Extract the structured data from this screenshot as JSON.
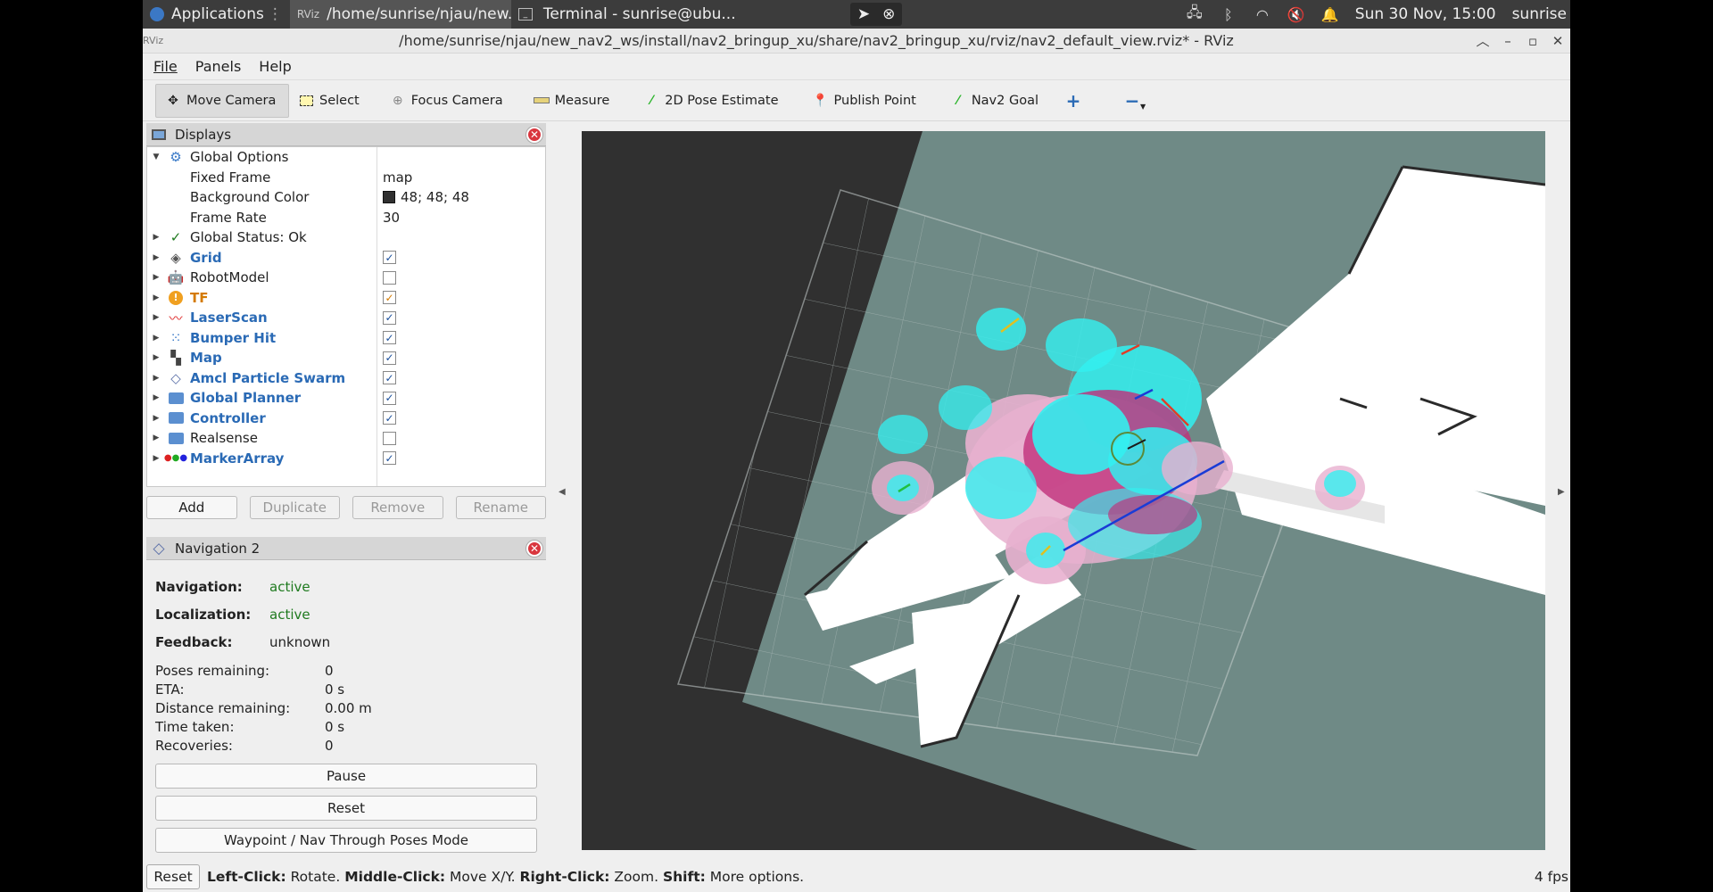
{
  "taskbar": {
    "applications": "Applications",
    "task1": "/home/sunrise/njau/new...",
    "task2": "Terminal - sunrise@ubu...",
    "datetime": "Sun 30 Nov, 15:00",
    "user": "sunrise"
  },
  "window": {
    "title": "/home/sunrise/njau/new_nav2_ws/install/nav2_bringup_xu/share/nav2_bringup_xu/rviz/nav2_default_view.rviz* - RViz"
  },
  "menu": {
    "file": "File",
    "panels": "Panels",
    "help": "Help"
  },
  "toolbar": {
    "move_camera": "Move Camera",
    "select": "Select",
    "focus_camera": "Focus Camera",
    "measure": "Measure",
    "pose_estimate": "2D Pose Estimate",
    "publish_point": "Publish Point",
    "nav2_goal": "Nav2 Goal"
  },
  "displays": {
    "header": "Displays",
    "global_options": "Global Options",
    "fixed_frame_label": "Fixed Frame",
    "fixed_frame_value": "map",
    "background_color_label": "Background Color",
    "background_color_value": "48; 48; 48",
    "background_color_hex": "#303030",
    "frame_rate_label": "Frame Rate",
    "frame_rate_value": "30",
    "global_status": "Global Status: Ok",
    "items": [
      {
        "name": "Grid",
        "checked": true
      },
      {
        "name": "RobotModel",
        "checked": false
      },
      {
        "name": "TF",
        "checked": true
      },
      {
        "name": "LaserScan",
        "checked": true
      },
      {
        "name": "Bumper Hit",
        "checked": true
      },
      {
        "name": "Map",
        "checked": true
      },
      {
        "name": "Amcl Particle Swarm",
        "checked": true
      },
      {
        "name": "Global Planner",
        "checked": true
      },
      {
        "name": "Controller",
        "checked": true
      },
      {
        "name": "Realsense",
        "checked": false
      },
      {
        "name": "MarkerArray",
        "checked": true
      }
    ],
    "buttons": {
      "add": "Add",
      "duplicate": "Duplicate",
      "remove": "Remove",
      "rename": "Rename"
    }
  },
  "nav2": {
    "header": "Navigation 2",
    "navigation_label": "Navigation:",
    "navigation_value": "active",
    "localization_label": "Localization:",
    "localization_value": "active",
    "feedback_label": "Feedback:",
    "feedback_value": "unknown",
    "poses_remaining_label": "Poses remaining:",
    "poses_remaining_value": "0",
    "eta_label": "ETA:",
    "eta_value": "0 s",
    "distance_label": "Distance remaining:",
    "distance_value": "0.00 m",
    "time_taken_label": "Time taken:",
    "time_taken_value": "0 s",
    "recoveries_label": "Recoveries:",
    "recoveries_value": "0",
    "pause": "Pause",
    "reset": "Reset",
    "waypoint": "Waypoint / Nav Through Poses Mode"
  },
  "statusbar": {
    "reset": "Reset",
    "left_click": "Left-Click:",
    "left_click_desc": " Rotate. ",
    "middle_click": "Middle-Click:",
    "middle_click_desc": " Move X/Y. ",
    "right_click": "Right-Click:",
    "right_click_desc": " Zoom. ",
    "shift": "Shift:",
    "shift_desc": " More options.",
    "fps": "4 fps"
  },
  "colors": {
    "viewport_bg": "#303030",
    "map_free": "#ffffff",
    "map_unknown": "#6f8a86",
    "costmap_cyan": "#33f0f0",
    "costmap_magenta": "#c0307a",
    "costmap_pink": "#e8b0cf"
  }
}
